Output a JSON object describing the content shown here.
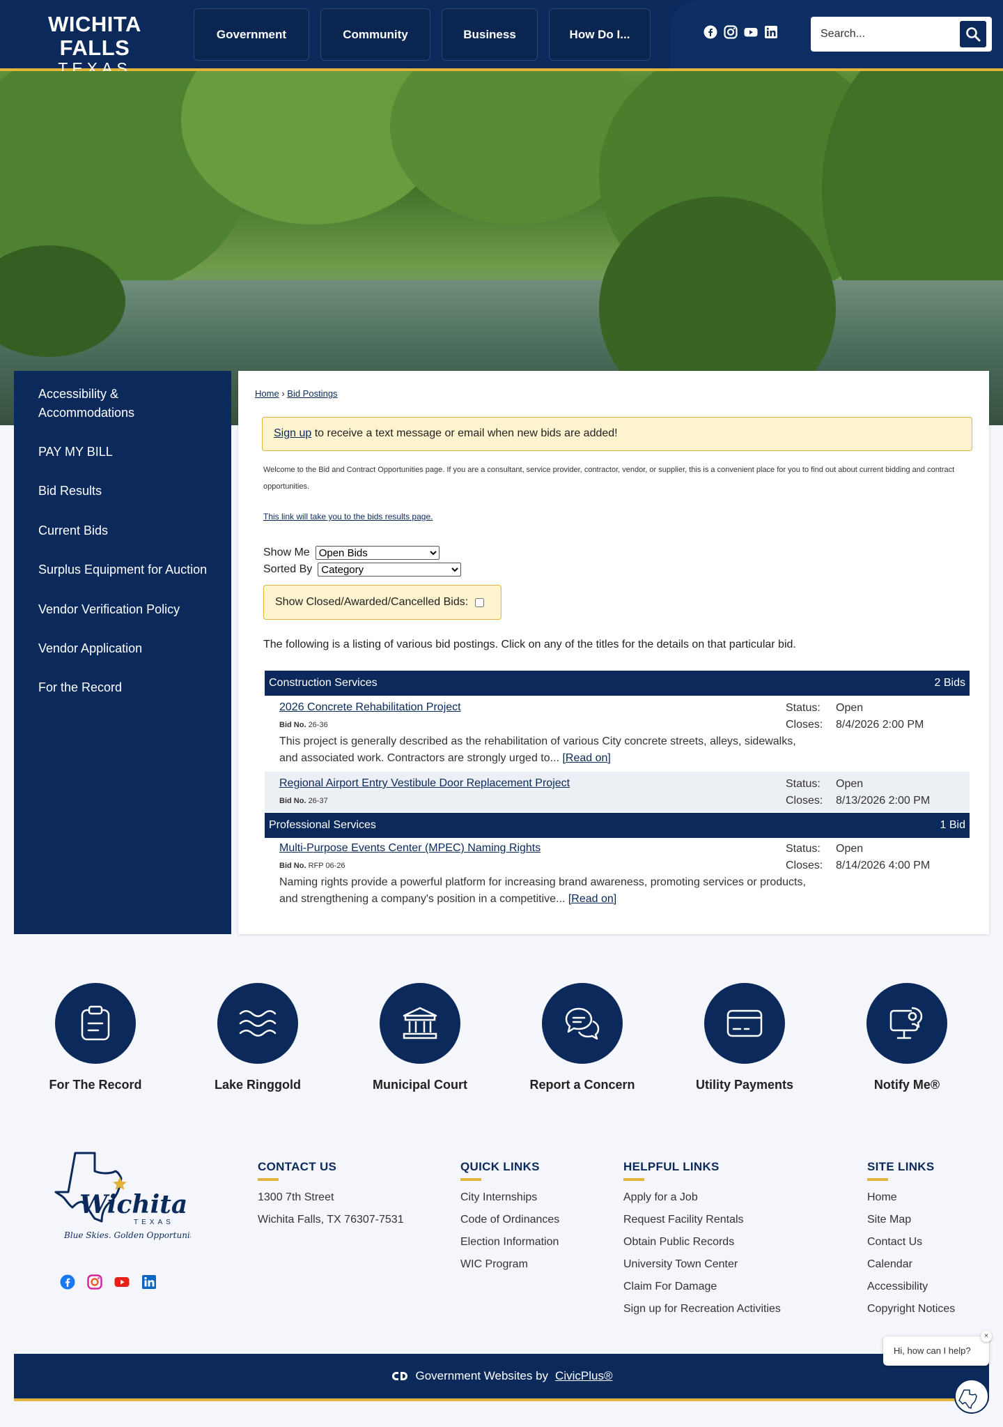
{
  "header": {
    "logo_line1": "WICHITA FALLS",
    "logo_line2": "TEXAS",
    "nav": [
      {
        "label": "Government"
      },
      {
        "label": "Community"
      },
      {
        "label": "Business"
      },
      {
        "label": "How Do I..."
      }
    ],
    "social_icons": [
      "facebook-icon",
      "instagram-icon",
      "youtube-icon",
      "linkedin-icon"
    ],
    "search_placeholder": "Search..."
  },
  "sidebar": {
    "items": [
      {
        "label": "Accessibility & Accommodations"
      },
      {
        "label": "PAY MY BILL"
      },
      {
        "label": "Bid Results"
      },
      {
        "label": "Current Bids"
      },
      {
        "label": "Surplus Equipment for Auction"
      },
      {
        "label": "Vendor Verification Policy"
      },
      {
        "label": "Vendor Application"
      },
      {
        "label": "For the Record"
      }
    ]
  },
  "main": {
    "breadcrumb": {
      "home": "Home",
      "sep": "›",
      "current": "Bid Postings"
    },
    "alert": {
      "link": "Sign up",
      "text": " to receive a text message or email when new bids are added!"
    },
    "intro": "Welcome to the Bid and Contract Opportunities page. If you are a consultant, service provider, contractor, vendor, or supplier, this is a convenient place for you to find out about current bidding and contract opportunities.",
    "results_link": "This link will take you to the bids results page.",
    "show_me": {
      "label": "Show Me",
      "value": "Open Bids"
    },
    "sorted_by": {
      "label": "Sorted By",
      "value": "Category"
    },
    "closed_label": "Show Closed/Awarded/Cancelled Bids:",
    "listing_intro": "The following is a listing of various bid postings. Click on any of the titles for the details on that particular bid.",
    "categories": [
      {
        "name": "Construction Services",
        "count": "2 Bids",
        "bids": [
          {
            "title": "2026 Concrete Rehabilitation Project",
            "no_label": "Bid No.",
            "no": "26-36",
            "desc": "This project is generally described as the rehabilitation of various City concrete streets, alleys, sidewalks, and associated work. Contractors are strongly urged to...",
            "read_on": "[Read on]",
            "status_label": "Status:",
            "status": "Open",
            "closes_label": "Closes:",
            "closes": "8/4/2026 2:00 PM"
          },
          {
            "title": "Regional Airport Entry Vestibule Door Replacement Project",
            "no_label": "Bid No.",
            "no": "26-37",
            "status_label": "Status:",
            "status": "Open",
            "closes_label": "Closes:",
            "closes": "8/13/2026 2:00 PM"
          }
        ]
      },
      {
        "name": "Professional Services",
        "count": "1 Bid",
        "bids": [
          {
            "title": "Multi-Purpose Events Center (MPEC) Naming Rights",
            "no_label": "Bid No.",
            "no": "RFP 06-26",
            "desc": "Naming rights provide a powerful platform for increasing brand awareness, promoting services or products, and strengthening a company's position in a competitive...",
            "read_on": "[Read on]",
            "status_label": "Status:",
            "status": "Open",
            "closes_label": "Closes:",
            "closes": "8/14/2026 4:00 PM"
          }
        ]
      }
    ]
  },
  "quick_icons": [
    {
      "label": "For The Record",
      "icon": "clipboard-icon"
    },
    {
      "label": "Lake Ringgold",
      "icon": "waves-icon"
    },
    {
      "label": "Municipal Court",
      "icon": "courthouse-icon"
    },
    {
      "label": "Report a Concern",
      "icon": "chat-bubbles-icon"
    },
    {
      "label": "Utility Payments",
      "icon": "credit-card-icon"
    },
    {
      "label": "Notify Me®",
      "icon": "notify-monitor-icon"
    }
  ],
  "footer": {
    "logo_text": "Wichita Falls",
    "logo_state": "TEXAS",
    "logo_tagline": "Blue Skies. Golden Opportunities.",
    "contact": {
      "title": "CONTACT US",
      "rows": [
        "1300 7th Street",
        "Wichita Falls, TX 76307-7531"
      ]
    },
    "quick_links": {
      "title": "QUICK LINKS",
      "rows": [
        "City Internships",
        "Code of Ordinances",
        "Election Information",
        "WIC Program"
      ]
    },
    "helpful_links": {
      "title": "HELPFUL LINKS",
      "rows": [
        "Apply for a Job",
        "Request Facility Rentals",
        "Obtain Public Records",
        "University Town Center",
        "Claim For Damage",
        "Sign up for Recreation Activities"
      ]
    },
    "site_links": {
      "title": "SITE LINKS",
      "rows": [
        "Home",
        "Site Map",
        "Contact Us",
        "Calendar",
        "Accessibility",
        "Copyright Notices"
      ]
    },
    "bottom_text": "Government Websites by",
    "bottom_link": "CivicPlus®"
  },
  "chat": {
    "text": "Hi, how can I help?",
    "close": "×"
  },
  "colors": {
    "navy": "#0b2a5b",
    "gold": "#e2b33a",
    "alert_bg": "#fdf4cf"
  }
}
